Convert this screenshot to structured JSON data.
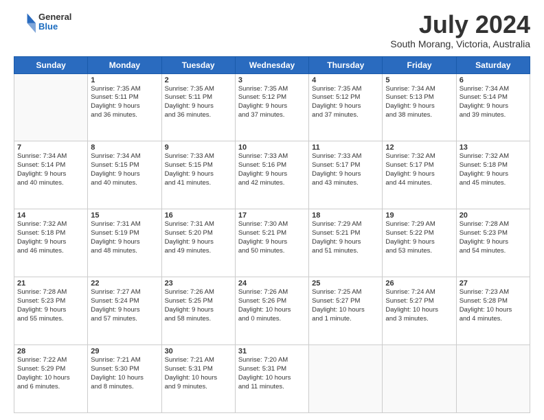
{
  "logo": {
    "general": "General",
    "blue": "Blue"
  },
  "title": "July 2024",
  "location": "South Morang, Victoria, Australia",
  "days_header": [
    "Sunday",
    "Monday",
    "Tuesday",
    "Wednesday",
    "Thursday",
    "Friday",
    "Saturday"
  ],
  "weeks": [
    [
      {
        "day": "",
        "info": ""
      },
      {
        "day": "1",
        "info": "Sunrise: 7:35 AM\nSunset: 5:11 PM\nDaylight: 9 hours\nand 36 minutes."
      },
      {
        "day": "2",
        "info": "Sunrise: 7:35 AM\nSunset: 5:11 PM\nDaylight: 9 hours\nand 36 minutes."
      },
      {
        "day": "3",
        "info": "Sunrise: 7:35 AM\nSunset: 5:12 PM\nDaylight: 9 hours\nand 37 minutes."
      },
      {
        "day": "4",
        "info": "Sunrise: 7:35 AM\nSunset: 5:12 PM\nDaylight: 9 hours\nand 37 minutes."
      },
      {
        "day": "5",
        "info": "Sunrise: 7:34 AM\nSunset: 5:13 PM\nDaylight: 9 hours\nand 38 minutes."
      },
      {
        "day": "6",
        "info": "Sunrise: 7:34 AM\nSunset: 5:14 PM\nDaylight: 9 hours\nand 39 minutes."
      }
    ],
    [
      {
        "day": "7",
        "info": "Sunrise: 7:34 AM\nSunset: 5:14 PM\nDaylight: 9 hours\nand 40 minutes."
      },
      {
        "day": "8",
        "info": "Sunrise: 7:34 AM\nSunset: 5:15 PM\nDaylight: 9 hours\nand 40 minutes."
      },
      {
        "day": "9",
        "info": "Sunrise: 7:33 AM\nSunset: 5:15 PM\nDaylight: 9 hours\nand 41 minutes."
      },
      {
        "day": "10",
        "info": "Sunrise: 7:33 AM\nSunset: 5:16 PM\nDaylight: 9 hours\nand 42 minutes."
      },
      {
        "day": "11",
        "info": "Sunrise: 7:33 AM\nSunset: 5:17 PM\nDaylight: 9 hours\nand 43 minutes."
      },
      {
        "day": "12",
        "info": "Sunrise: 7:32 AM\nSunset: 5:17 PM\nDaylight: 9 hours\nand 44 minutes."
      },
      {
        "day": "13",
        "info": "Sunrise: 7:32 AM\nSunset: 5:18 PM\nDaylight: 9 hours\nand 45 minutes."
      }
    ],
    [
      {
        "day": "14",
        "info": "Sunrise: 7:32 AM\nSunset: 5:18 PM\nDaylight: 9 hours\nand 46 minutes."
      },
      {
        "day": "15",
        "info": "Sunrise: 7:31 AM\nSunset: 5:19 PM\nDaylight: 9 hours\nand 48 minutes."
      },
      {
        "day": "16",
        "info": "Sunrise: 7:31 AM\nSunset: 5:20 PM\nDaylight: 9 hours\nand 49 minutes."
      },
      {
        "day": "17",
        "info": "Sunrise: 7:30 AM\nSunset: 5:21 PM\nDaylight: 9 hours\nand 50 minutes."
      },
      {
        "day": "18",
        "info": "Sunrise: 7:29 AM\nSunset: 5:21 PM\nDaylight: 9 hours\nand 51 minutes."
      },
      {
        "day": "19",
        "info": "Sunrise: 7:29 AM\nSunset: 5:22 PM\nDaylight: 9 hours\nand 53 minutes."
      },
      {
        "day": "20",
        "info": "Sunrise: 7:28 AM\nSunset: 5:23 PM\nDaylight: 9 hours\nand 54 minutes."
      }
    ],
    [
      {
        "day": "21",
        "info": "Sunrise: 7:28 AM\nSunset: 5:23 PM\nDaylight: 9 hours\nand 55 minutes."
      },
      {
        "day": "22",
        "info": "Sunrise: 7:27 AM\nSunset: 5:24 PM\nDaylight: 9 hours\nand 57 minutes."
      },
      {
        "day": "23",
        "info": "Sunrise: 7:26 AM\nSunset: 5:25 PM\nDaylight: 9 hours\nand 58 minutes."
      },
      {
        "day": "24",
        "info": "Sunrise: 7:26 AM\nSunset: 5:26 PM\nDaylight: 10 hours\nand 0 minutes."
      },
      {
        "day": "25",
        "info": "Sunrise: 7:25 AM\nSunset: 5:27 PM\nDaylight: 10 hours\nand 1 minute."
      },
      {
        "day": "26",
        "info": "Sunrise: 7:24 AM\nSunset: 5:27 PM\nDaylight: 10 hours\nand 3 minutes."
      },
      {
        "day": "27",
        "info": "Sunrise: 7:23 AM\nSunset: 5:28 PM\nDaylight: 10 hours\nand 4 minutes."
      }
    ],
    [
      {
        "day": "28",
        "info": "Sunrise: 7:22 AM\nSunset: 5:29 PM\nDaylight: 10 hours\nand 6 minutes."
      },
      {
        "day": "29",
        "info": "Sunrise: 7:21 AM\nSunset: 5:30 PM\nDaylight: 10 hours\nand 8 minutes."
      },
      {
        "day": "30",
        "info": "Sunrise: 7:21 AM\nSunset: 5:31 PM\nDaylight: 10 hours\nand 9 minutes."
      },
      {
        "day": "31",
        "info": "Sunrise: 7:20 AM\nSunset: 5:31 PM\nDaylight: 10 hours\nand 11 minutes."
      },
      {
        "day": "",
        "info": ""
      },
      {
        "day": "",
        "info": ""
      },
      {
        "day": "",
        "info": ""
      }
    ]
  ]
}
